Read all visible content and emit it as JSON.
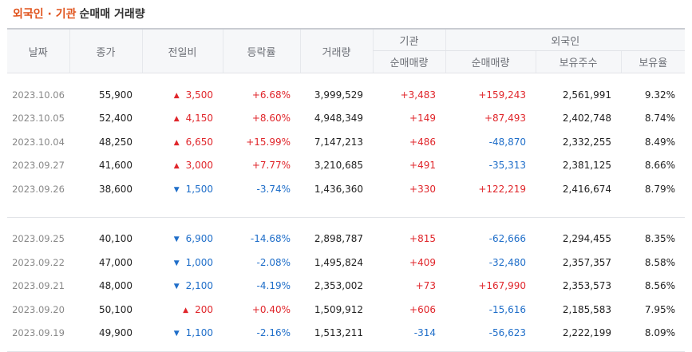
{
  "title": {
    "highlight": "외국인 · 기관",
    "rest": "순매매 거래량"
  },
  "headers": {
    "date": "날짜",
    "close": "종가",
    "change": "전일비",
    "rate": "등락률",
    "volume": "거래량",
    "institution": "기관",
    "foreign": "외국인",
    "inst_net": "순매매량",
    "foreign_net": "순매매량",
    "holdings": "보유주수",
    "holding_ratio": "보유율"
  },
  "colors": {
    "up": "#e0262b",
    "down": "#1f6ec9",
    "accent": "#e0531c"
  },
  "icons": {
    "up": "triangle-up-icon",
    "down": "triangle-down-icon"
  },
  "groups": [
    [
      {
        "date": "2023.10.06",
        "close": "55,900",
        "dir": "up",
        "arrow": "▲",
        "change": "3,500",
        "rate": "+6.68%",
        "volume": "3,999,529",
        "inst_net": "+3,483",
        "inst_dir": "up",
        "foreign_net": "+159,243",
        "foreign_dir": "up",
        "holdings": "2,561,991",
        "ratio": "9.32%"
      },
      {
        "date": "2023.10.05",
        "close": "52,400",
        "dir": "up",
        "arrow": "▲",
        "change": "4,150",
        "rate": "+8.60%",
        "volume": "4,948,349",
        "inst_net": "+149",
        "inst_dir": "up",
        "foreign_net": "+87,493",
        "foreign_dir": "up",
        "holdings": "2,402,748",
        "ratio": "8.74%"
      },
      {
        "date": "2023.10.04",
        "close": "48,250",
        "dir": "up",
        "arrow": "▲",
        "change": "6,650",
        "rate": "+15.99%",
        "volume": "7,147,213",
        "inst_net": "+486",
        "inst_dir": "up",
        "foreign_net": "-48,870",
        "foreign_dir": "down",
        "holdings": "2,332,255",
        "ratio": "8.49%"
      },
      {
        "date": "2023.09.27",
        "close": "41,600",
        "dir": "up",
        "arrow": "▲",
        "change": "3,000",
        "rate": "+7.77%",
        "volume": "3,210,685",
        "inst_net": "+491",
        "inst_dir": "up",
        "foreign_net": "-35,313",
        "foreign_dir": "down",
        "holdings": "2,381,125",
        "ratio": "8.66%"
      },
      {
        "date": "2023.09.26",
        "close": "38,600",
        "dir": "down",
        "arrow": "▼",
        "change": "1,500",
        "rate": "-3.74%",
        "volume": "1,436,360",
        "inst_net": "+330",
        "inst_dir": "up",
        "foreign_net": "+122,219",
        "foreign_dir": "up",
        "holdings": "2,416,674",
        "ratio": "8.79%"
      }
    ],
    [
      {
        "date": "2023.09.25",
        "close": "40,100",
        "dir": "down",
        "arrow": "▼",
        "change": "6,900",
        "rate": "-14.68%",
        "volume": "2,898,787",
        "inst_net": "+815",
        "inst_dir": "up",
        "foreign_net": "-62,666",
        "foreign_dir": "down",
        "holdings": "2,294,455",
        "ratio": "8.35%"
      },
      {
        "date": "2023.09.22",
        "close": "47,000",
        "dir": "down",
        "arrow": "▼",
        "change": "1,000",
        "rate": "-2.08%",
        "volume": "1,495,824",
        "inst_net": "+409",
        "inst_dir": "up",
        "foreign_net": "-32,480",
        "foreign_dir": "down",
        "holdings": "2,357,357",
        "ratio": "8.58%"
      },
      {
        "date": "2023.09.21",
        "close": "48,000",
        "dir": "down",
        "arrow": "▼",
        "change": "2,100",
        "rate": "-4.19%",
        "volume": "2,353,002",
        "inst_net": "+73",
        "inst_dir": "up",
        "foreign_net": "+167,990",
        "foreign_dir": "up",
        "holdings": "2,353,573",
        "ratio": "8.56%"
      },
      {
        "date": "2023.09.20",
        "close": "50,100",
        "dir": "up",
        "arrow": "▲",
        "change": "200",
        "rate": "+0.40%",
        "volume": "1,509,912",
        "inst_net": "+606",
        "inst_dir": "up",
        "foreign_net": "-15,616",
        "foreign_dir": "down",
        "holdings": "2,185,583",
        "ratio": "7.95%"
      },
      {
        "date": "2023.09.19",
        "close": "49,900",
        "dir": "down",
        "arrow": "▼",
        "change": "1,100",
        "rate": "-2.16%",
        "volume": "1,513,211",
        "inst_net": "-314",
        "inst_dir": "down",
        "foreign_net": "-56,623",
        "foreign_dir": "down",
        "holdings": "2,222,199",
        "ratio": "8.09%"
      }
    ]
  ]
}
